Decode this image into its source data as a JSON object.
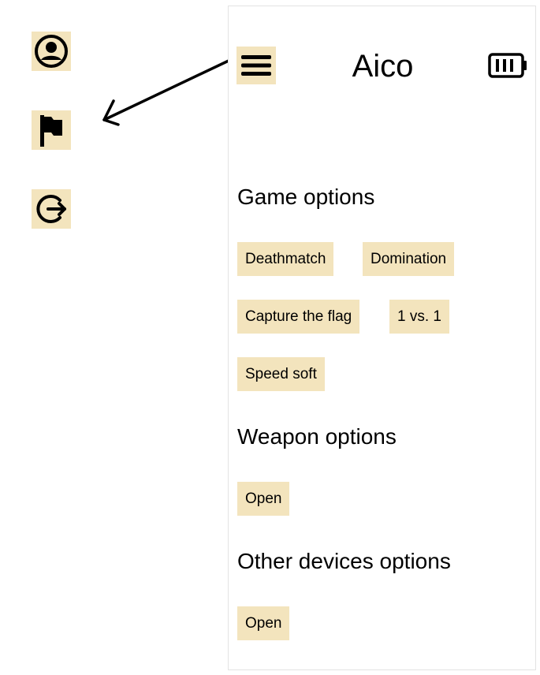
{
  "side_menu": {
    "items": [
      {
        "icon": "account-circle-icon"
      },
      {
        "icon": "flag-icon"
      },
      {
        "icon": "logout-icon"
      }
    ]
  },
  "header": {
    "title": "Aico",
    "menu_icon": "hamburger-menu-icon",
    "battery_icon": "battery-icon"
  },
  "sections": {
    "game": {
      "title": "Game options",
      "options": [
        "Deathmatch",
        "Domination",
        "Capture the flag",
        "1 vs. 1",
        "Speed soft"
      ]
    },
    "weapon": {
      "title": "Weapon options",
      "open_label": "Open"
    },
    "other_devices": {
      "title": "Other devices options",
      "open_label": "Open"
    }
  },
  "colors": {
    "chip_background": "#f3e4bd",
    "text": "#000000",
    "panel_border": "#e3e3e3"
  }
}
